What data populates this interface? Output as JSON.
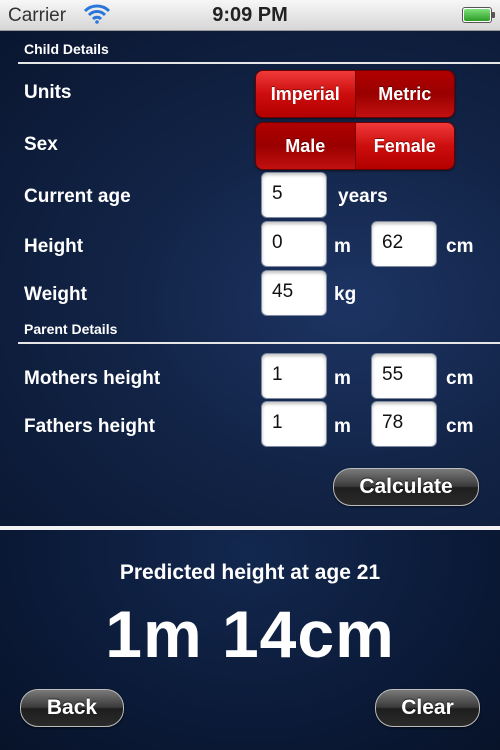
{
  "status_bar": {
    "carrier": "Carrier",
    "time": "9:09 PM",
    "icons": [
      "wifi-icon",
      "battery-icon"
    ]
  },
  "child_details": {
    "heading": "Child Details",
    "units": {
      "label": "Units",
      "options": [
        "Imperial",
        "Metric"
      ],
      "selected": "Metric"
    },
    "sex": {
      "label": "Sex",
      "options": [
        "Male",
        "Female"
      ],
      "selected": "Female"
    },
    "current_age": {
      "label": "Current age",
      "value": "5",
      "unit": "years"
    },
    "height": {
      "label": "Height",
      "m_value": "0",
      "m_unit": "m",
      "cm_value": "62",
      "cm_unit": "cm"
    },
    "weight": {
      "label": "Weight",
      "value": "45",
      "unit": "kg"
    }
  },
  "parent_details": {
    "heading": "Parent Details",
    "mothers_height": {
      "label": "Mothers height",
      "m_value": "1",
      "m_unit": "m",
      "cm_value": "55",
      "cm_unit": "cm"
    },
    "fathers_height": {
      "label": "Fathers height",
      "m_value": "1",
      "m_unit": "m",
      "cm_value": "78",
      "cm_unit": "cm"
    }
  },
  "actions": {
    "calculate": "Calculate",
    "back": "Back",
    "clear": "Clear"
  },
  "result": {
    "label": "Predicted height at age 21",
    "value": "1m 14cm"
  },
  "colors": {
    "segment_red": "#cc0d0d",
    "background_navy": "#122447"
  }
}
